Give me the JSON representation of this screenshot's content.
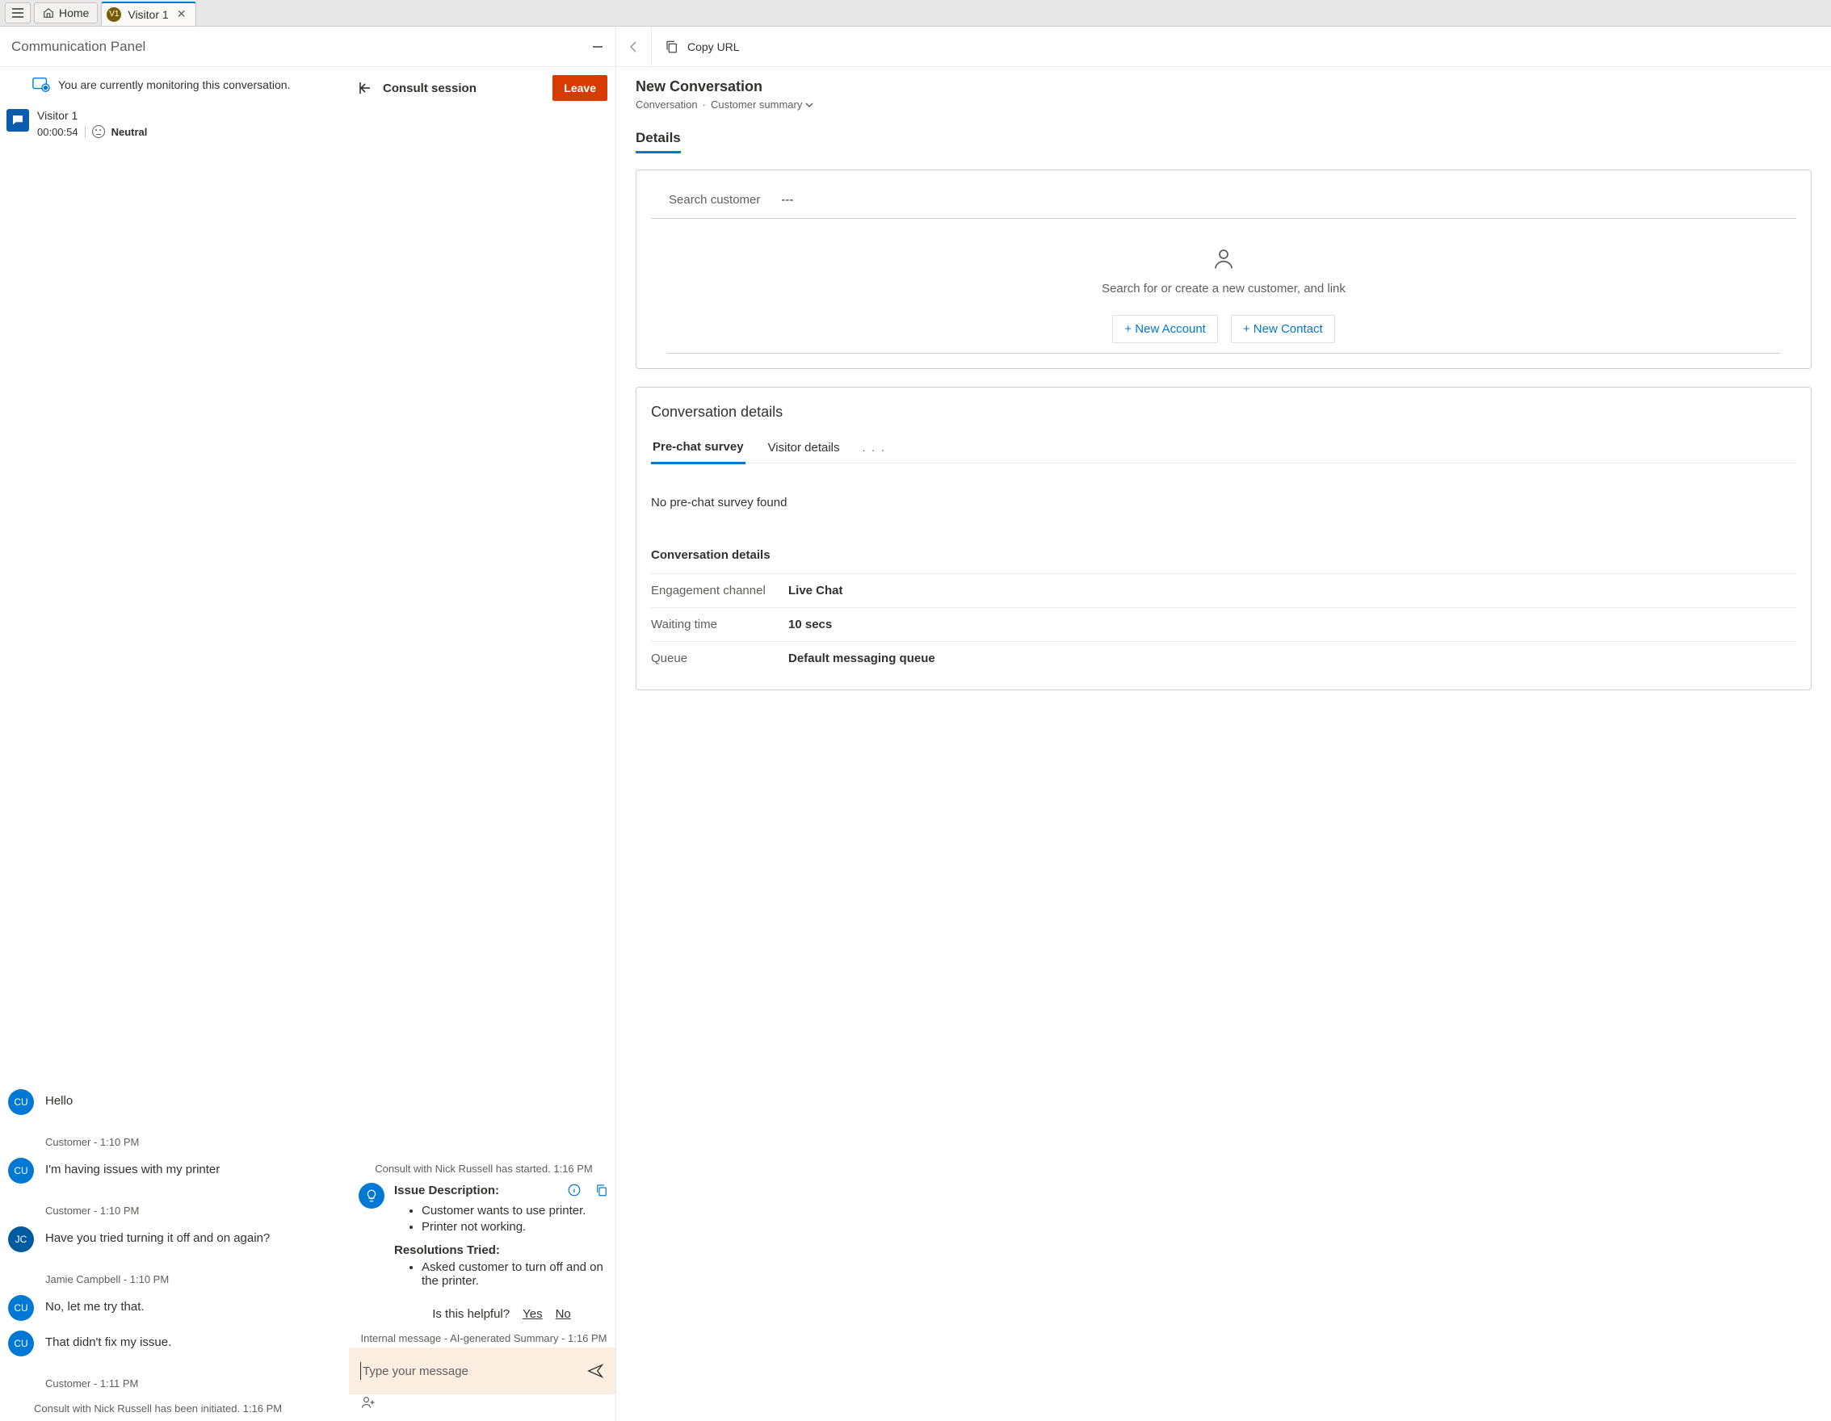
{
  "topbar": {
    "home_label": "Home",
    "tab": {
      "badge": "V1",
      "label": "Visitor 1"
    }
  },
  "panel": {
    "title": "Communication Panel",
    "monitor_text": "You are currently monitoring this conversation."
  },
  "visitor": {
    "name": "Visitor 1",
    "timer": "00:00:54",
    "sentiment": "Neutral"
  },
  "conversation": {
    "messages": [
      {
        "avatar": "CU",
        "author": "Customer",
        "time": "1:10 PM",
        "text": "Hello"
      },
      {
        "avatar": "CU",
        "author": "Customer",
        "time": "1:10 PM",
        "text": "I'm having issues with my printer"
      },
      {
        "avatar": "JC",
        "author": "Jamie Campbell",
        "time": "1:10 PM",
        "text": "Have you tried turning it off and on again?"
      },
      {
        "avatar": "CU",
        "author": "Customer",
        "time": "",
        "text": "No, let me try that."
      },
      {
        "avatar": "CU",
        "author": "Customer",
        "time": "1:11 PM",
        "text": "That didn't fix my issue."
      }
    ],
    "system_initiated": "Consult with Nick Russell has been initiated. 1:16 PM"
  },
  "consult": {
    "title": "Consult session",
    "leave_label": "Leave",
    "started_msg": "Consult with Nick Russell has started. 1:16 PM",
    "ai": {
      "issue_label": "Issue Description:",
      "issue_items": [
        "Customer wants to use printer.",
        "Printer not working."
      ],
      "resolutions_label": "Resolutions Tried:",
      "resolutions_items": [
        "Asked customer to turn off and on the printer."
      ],
      "helpful_q": "Is this helpful?",
      "yes": "Yes",
      "no": "No",
      "meta": "Internal message - AI-generated Summary - 1:16 PM"
    },
    "compose_placeholder": "Type your message"
  },
  "right": {
    "copy_url": "Copy URL",
    "title": "New Conversation",
    "breadcrumb_conversation": "Conversation",
    "breadcrumb_summary": "Customer summary",
    "details_tab": "Details",
    "search_customer_label": "Search customer",
    "search_customer_value": "---",
    "empty_text": "Search for or create a new customer, and link",
    "new_account": "+ New Account",
    "new_contact": "+ New Contact",
    "conv_details_title": "Conversation details",
    "tabs": {
      "prechat": "Pre-chat survey",
      "visitor": "Visitor details",
      "overflow": ". . ."
    },
    "no_survey": "No pre-chat survey found",
    "sub_heading": "Conversation details",
    "kv": [
      {
        "k": "Engagement channel",
        "v": "Live Chat"
      },
      {
        "k": "Waiting time",
        "v": "10 secs"
      },
      {
        "k": "Queue",
        "v": "Default messaging queue"
      }
    ]
  }
}
